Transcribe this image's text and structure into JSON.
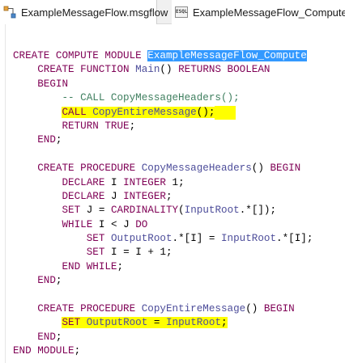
{
  "tabs": [
    {
      "label": "ExampleMessageFlow.msgflow",
      "icon": "msgflow-icon"
    },
    {
      "label": "ExampleMessageFlow_Compute.esql",
      "icon": "esql-file-icon",
      "icon_text": "ESQL"
    }
  ],
  "code": {
    "l1": {
      "kw": "CREATE COMPUTE MODULE",
      "name": "ExampleMessageFlow_Compute"
    },
    "l2": {
      "indent": "    ",
      "kw1": "CREATE FUNCTION",
      "name": "Main",
      "rest1": "() ",
      "kw2": "RETURNS BOOLEAN"
    },
    "l3": {
      "indent": "    ",
      "kw": "BEGIN"
    },
    "l4": {
      "indent": "        ",
      "comment": "-- CALL CopyMessageHeaders();"
    },
    "l5": {
      "indent": "        ",
      "kw": "CALL",
      "name": "CopyEntireMessage",
      "rest": "();"
    },
    "l6": {
      "indent": "        ",
      "kw": "RETURN TRUE",
      "rest": ";"
    },
    "l7": {
      "indent": "    ",
      "kw": "END",
      "rest": ";"
    },
    "l8": {
      "text": ""
    },
    "l9": {
      "indent": "    ",
      "kw": "CREATE PROCEDURE",
      "name": "CopyMessageHeaders",
      "rest": "() ",
      "kw2": "BEGIN"
    },
    "l10": {
      "indent": "        ",
      "kw": "DECLARE",
      "name": "I",
      "kw2": "INTEGER",
      "rest": " 1;"
    },
    "l11": {
      "indent": "        ",
      "kw": "DECLARE",
      "name": "J",
      "kw2": "INTEGER",
      "rest": ";"
    },
    "l12": {
      "indent": "        ",
      "kw": "SET",
      "name": "J",
      "rest1": " = ",
      "kw2": "CARDINALITY",
      "rest2": "(",
      "name2": "InputRoot",
      "rest3": ".*[]);"
    },
    "l13": {
      "indent": "        ",
      "kw": "WHILE",
      "name": "I",
      "rest": " < ",
      "name2": "J",
      "kw2": "DO"
    },
    "l14": {
      "indent": "            ",
      "kw": "SET",
      "name": "OutputRoot",
      "rest1": ".*[I] = ",
      "name2": "InputRoot",
      "rest2": ".*[I];"
    },
    "l15": {
      "indent": "            ",
      "kw": "SET",
      "name": "I",
      "rest1": " = ",
      "name2": "I",
      "rest2": " + 1;"
    },
    "l16": {
      "indent": "        ",
      "kw": "END WHILE",
      "rest": ";"
    },
    "l17": {
      "indent": "    ",
      "kw": "END",
      "rest": ";"
    },
    "l18": {
      "text": ""
    },
    "l19": {
      "indent": "    ",
      "kw": "CREATE PROCEDURE",
      "name": "CopyEntireMessage",
      "rest": "() ",
      "kw2": "BEGIN"
    },
    "l20": {
      "indent": "        ",
      "kw": "SET",
      "name": "OutputRoot",
      "rest": " = ",
      "name2": "InputRoot",
      "rest2": ";"
    },
    "l21": {
      "indent": "    ",
      "kw": "END",
      "rest": ";"
    },
    "l22": {
      "kw": "END MODULE",
      "rest": ";"
    }
  },
  "colors": {
    "keyword": "#7f0055",
    "identifier": "#4d4d9a",
    "comment": "#3f7f5f",
    "selection": "#3399ff",
    "highlight": "#ffff00"
  }
}
